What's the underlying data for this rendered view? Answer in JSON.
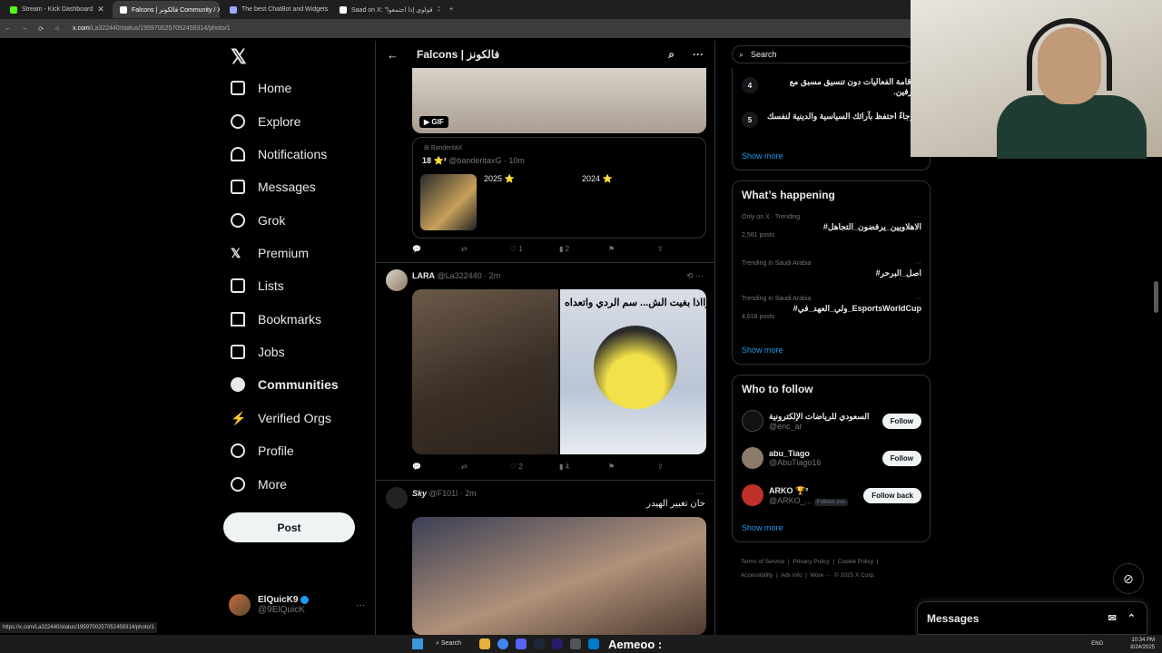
{
  "browser": {
    "tabs": [
      {
        "title": "Stream - Kick Dashboard",
        "active": false,
        "favicon_color": "#53fc18"
      },
      {
        "title": "Falcons | فالكونز Community / X",
        "active": true,
        "favicon_color": "#ffffff"
      },
      {
        "title": "The best ChatBot and Widgets",
        "active": false,
        "favicon_color": "#9ba6ff"
      },
      {
        "title": "Saad on X: \"قولوي إذا اجتمعوا",
        "active": false,
        "favicon_color": "#ffffff"
      }
    ],
    "url_domain": "x.com",
    "url_path": "/La322440/status/1959700257052459314/photo/1",
    "status_bar_url": "https://x.com/La322440/status/1959700257052459314/photo/1"
  },
  "nav": {
    "logo": "𝕏",
    "items": [
      {
        "label": "Home",
        "icon": "home-icon"
      },
      {
        "label": "Explore",
        "icon": "search-icon"
      },
      {
        "label": "Notifications",
        "icon": "bell-icon"
      },
      {
        "label": "Messages",
        "icon": "mail-icon"
      },
      {
        "label": "Grok",
        "icon": "grok-icon"
      },
      {
        "label": "Premium",
        "icon": "x-premium-icon"
      },
      {
        "label": "Lists",
        "icon": "list-icon"
      },
      {
        "label": "Bookmarks",
        "icon": "bookmark-icon"
      },
      {
        "label": "Jobs",
        "icon": "briefcase-icon"
      },
      {
        "label": "Communities",
        "icon": "communities-icon"
      },
      {
        "label": "Verified Orgs",
        "icon": "lightning-icon"
      },
      {
        "label": "Profile",
        "icon": "person-icon"
      },
      {
        "label": "More",
        "icon": "more-circle-icon"
      }
    ],
    "post_label": "Post",
    "account": {
      "name": "ElQuicK9",
      "handle": "@9ElQuicK"
    }
  },
  "header": {
    "title": "Falcons | فالكونز"
  },
  "timeline": {
    "gif_badge": "GIF",
    "quote": {
      "line": "BanderitaX",
      "user": "18 ⭐²",
      "handle": "@banderitaxG · 10m",
      "year1": "2025 ⭐",
      "year2": "2024 ⭐"
    },
    "actions1": {
      "reply": "",
      "retweet": "",
      "likes": "1",
      "views": "2"
    },
    "post2": {
      "name": "LARA",
      "handle": "@La322440 · 2m",
      "caption": "وااذا بغيت الش... سم الردي واتعداه"
    },
    "actions2": {
      "reply": "",
      "retweet": "",
      "likes": "2",
      "views": "4"
    },
    "post3": {
      "name": "Sky",
      "handle": "@F101l · 2m",
      "text": "حان تغيير الهيدر"
    }
  },
  "right": {
    "search_placeholder": "Search",
    "rules": [
      {
        "num": "4",
        "text": "4. ع إقامة الفعاليات دون تنسيق مسبق مع المشرفين."
      },
      {
        "num": "5",
        "text": "5. رجاءً احتفظ بآرائك السياسية والدينية لنفسك"
      }
    ],
    "show_more": "Show more",
    "happening_title": "What’s happening",
    "trends": [
      {
        "context": "Only on X · Trending",
        "name": "#الاهلاويين_يرفضون_التجاهل",
        "count": "2,581 posts"
      },
      {
        "context": "Trending in Saudi Arabia",
        "name": "#اصل_البرحر",
        "count": ""
      },
      {
        "context": "Trending in Saudi Arabia",
        "name": "#ولي_العهد_في_EsportsWorldCup",
        "count": "4,616 posts"
      }
    ],
    "follow_title": "Who to follow",
    "follow": [
      {
        "name": "الاتحاد السعودي للرياضات الإلكترونية",
        "handle": "@enc_ar",
        "button": "Follow",
        "follows_you": "",
        "color": "#111111"
      },
      {
        "name": "abu_Tiago",
        "handle": "@AbuTiago16",
        "button": "Follow",
        "follows_you": "",
        "color": "#8a7b6a"
      },
      {
        "name": "ARKO 🏆²",
        "handle": "@ARKO_...",
        "button": "Follow back",
        "follows_you": "Follows you",
        "color": "#c0302a"
      }
    ],
    "footer": {
      "terms": "Terms of Service",
      "privacy": "Privacy Policy",
      "cookie": "Cookie Policy",
      "accessibility": "Accessibility",
      "ads": "Ads info",
      "more": "More ···",
      "copyright": "© 2025 X Corp."
    }
  },
  "messages_dock": {
    "title": "Messages"
  },
  "taskbar": {
    "search": "Search",
    "ticker": "Aemeoo :",
    "lang": "ENG",
    "time": "10:34 PM",
    "date": "8/24/2025"
  }
}
